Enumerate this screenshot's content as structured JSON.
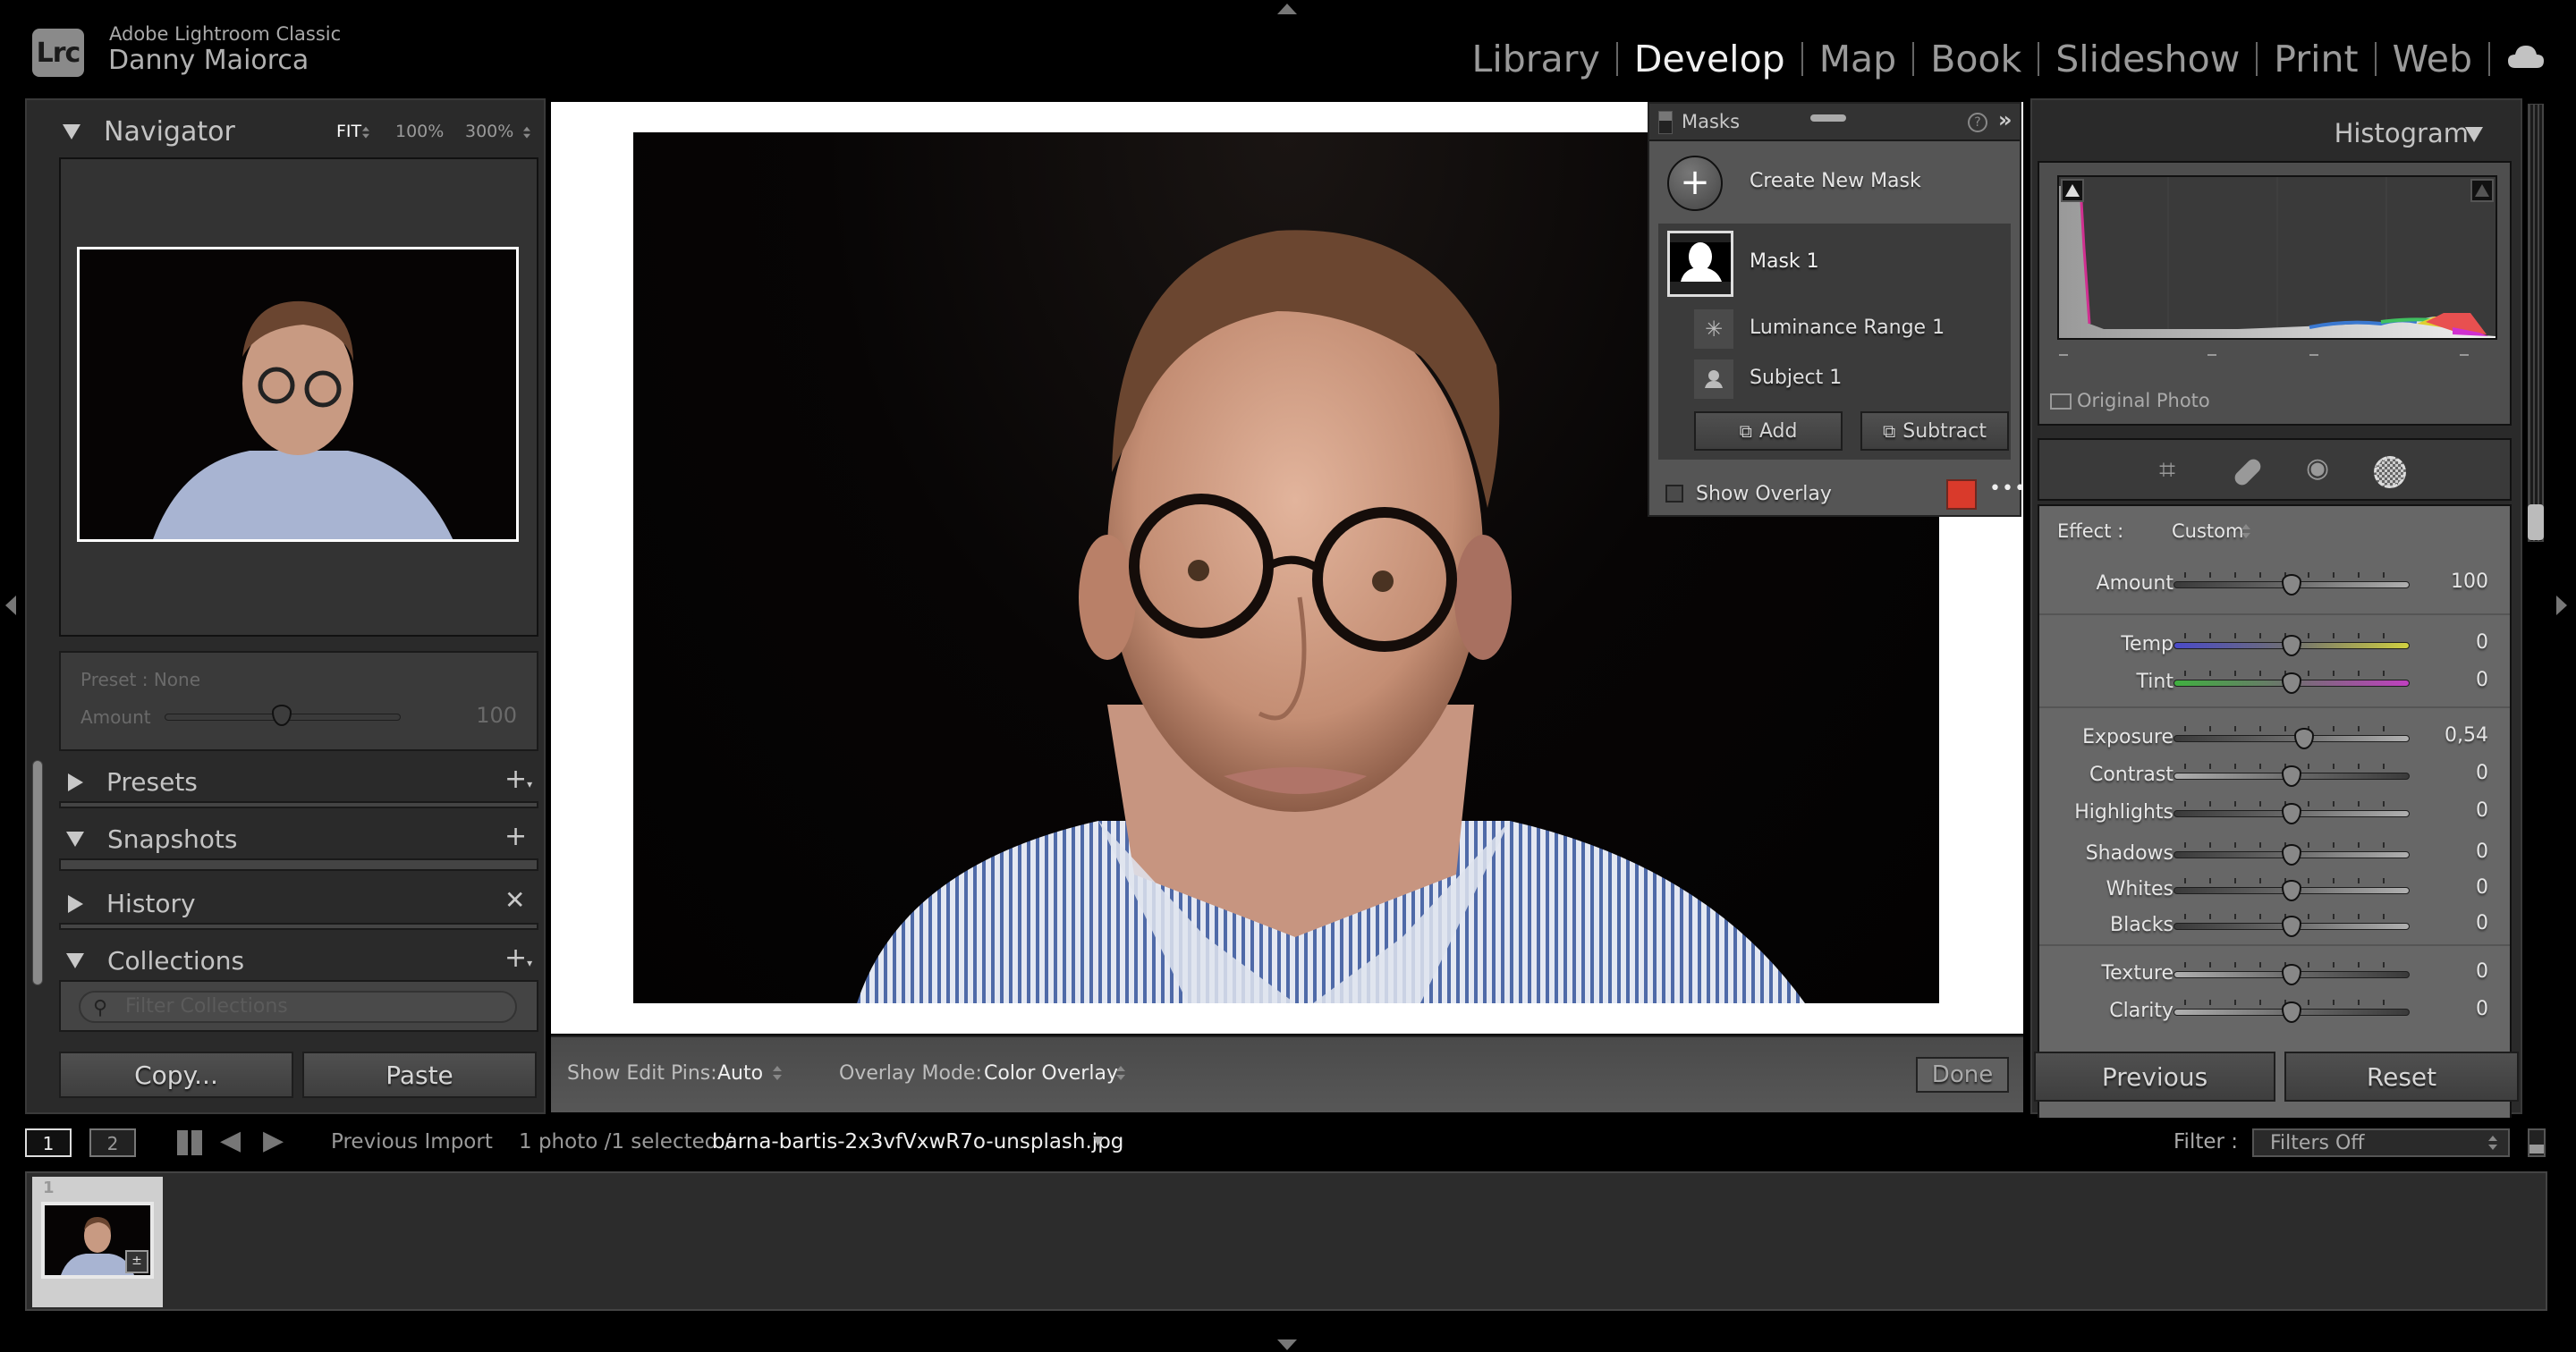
{
  "app": {
    "logo": "Lrc",
    "title": "Adobe Lightroom Classic",
    "user": "Danny Maiorca"
  },
  "modules": [
    {
      "label": "Library",
      "active": false
    },
    {
      "label": "Develop",
      "active": true
    },
    {
      "label": "Map",
      "active": false
    },
    {
      "label": "Book",
      "active": false
    },
    {
      "label": "Slideshow",
      "active": false
    },
    {
      "label": "Print",
      "active": false
    },
    {
      "label": "Web",
      "active": false
    }
  ],
  "cloud_icon": "cloud-icon",
  "left_panel": {
    "navigator": {
      "title": "Navigator",
      "zoom_options": [
        "FIT",
        "100%",
        "300%"
      ],
      "active_zoom": "FIT"
    },
    "preset_amount": {
      "preset_label": "Preset : None",
      "amount_label": "Amount",
      "amount_value": "100",
      "amount_fraction": 0.5
    },
    "sections": [
      {
        "title": "Presets",
        "expanded": false,
        "action_icon": "plus-dropdown-icon"
      },
      {
        "title": "Snapshots",
        "expanded": true,
        "action_icon": "plus-icon"
      },
      {
        "title": "History",
        "expanded": false,
        "action_icon": "clear-x-icon"
      },
      {
        "title": "Collections",
        "expanded": true,
        "action_icon": "plus-dropdown-icon"
      }
    ],
    "collections_filter_placeholder": "Filter Collections",
    "copy_button": "Copy...",
    "paste_button": "Paste"
  },
  "masks_panel": {
    "title": "Masks",
    "create_new": "Create New Mask",
    "mask_name": "Mask 1",
    "components": [
      {
        "name": "Luminance Range 1",
        "icon": "luminance-range-icon"
      },
      {
        "name": "Subject 1",
        "icon": "subject-icon"
      }
    ],
    "add_button": "Add",
    "subtract_button": "Subtract",
    "show_overlay_label": "Show Overlay",
    "show_overlay_checked": false,
    "overlay_color": "#d93a2b"
  },
  "center_toolbar": {
    "edit_pins_label": "Show Edit Pins:",
    "edit_pins_value": "Auto",
    "overlay_mode_label": "Overlay Mode:",
    "overlay_mode_value": "Color Overlay",
    "done_button": "Done"
  },
  "right_panel": {
    "histogram_title": "Histogram",
    "original_photo_label": "Original Photo",
    "original_photo_checked": false,
    "tools": [
      "crop-icon",
      "healing-icon",
      "red-eye-icon",
      "masking-icon"
    ],
    "effect_label": "Effect :",
    "effect_value": "Custom",
    "sliders": [
      {
        "label": "Amount",
        "value": "100",
        "pos": 0.5,
        "style": "gray"
      },
      {
        "label": "Temp",
        "value": "0",
        "pos": 0.5,
        "style": "temp"
      },
      {
        "label": "Tint",
        "value": "0",
        "pos": 0.5,
        "style": "tint"
      },
      {
        "label": "Exposure",
        "value": "0,54",
        "pos": 0.554,
        "style": "gray"
      },
      {
        "label": "Contrast",
        "value": "0",
        "pos": 0.5,
        "style": "inv"
      },
      {
        "label": "Highlights",
        "value": "0",
        "pos": 0.5,
        "style": "gray"
      },
      {
        "label": "Shadows",
        "value": "0",
        "pos": 0.5,
        "style": "gray"
      },
      {
        "label": "Whites",
        "value": "0",
        "pos": 0.5,
        "style": "gray"
      },
      {
        "label": "Blacks",
        "value": "0",
        "pos": 0.5,
        "style": "gray"
      },
      {
        "label": "Texture",
        "value": "0",
        "pos": 0.5,
        "style": "inv"
      },
      {
        "label": "Clarity",
        "value": "0",
        "pos": 0.5,
        "style": "inv"
      }
    ],
    "previous_button": "Previous",
    "reset_button": "Reset"
  },
  "filmstrip_bar": {
    "view1": "1",
    "view2": "2",
    "source": "Previous Import",
    "count": "1 photo /1 selected /",
    "filename": "barna-bartis-2x3vfVxwR7o-unsplash.jpg",
    "filter_label": "Filter :",
    "filter_value": "Filters Off"
  },
  "filmstrip": {
    "items": [
      {
        "index": "1",
        "badge_icon": "exposure-adjusted-icon"
      }
    ]
  }
}
